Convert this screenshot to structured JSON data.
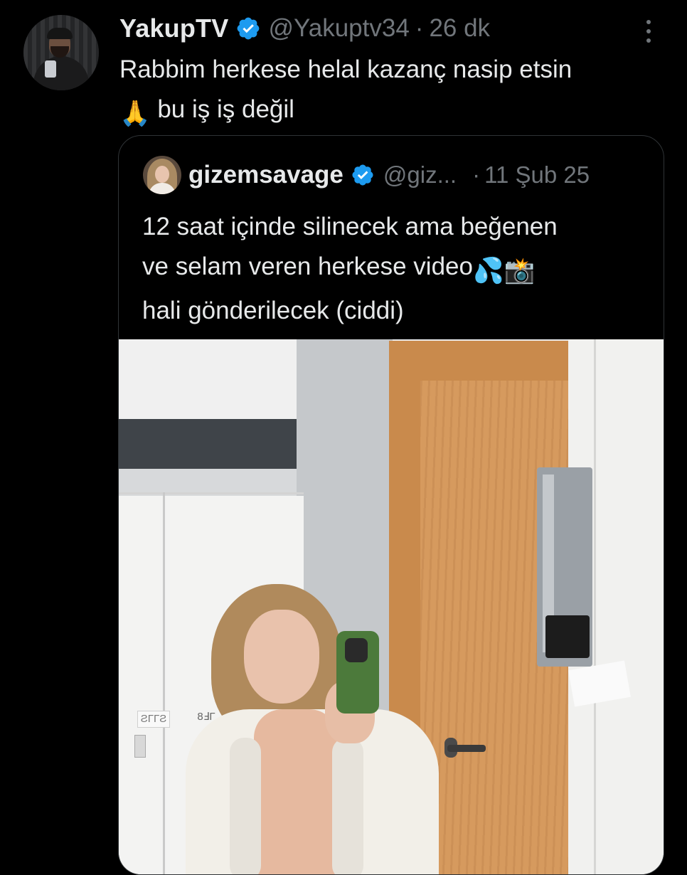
{
  "tweet": {
    "display_name": "YakupTV",
    "handle": "@Yakuptv34",
    "separator": "·",
    "time": "26 dk",
    "text_line_1": "Rabbim herkese helal kazanç nasip etsin",
    "text_line_2_emoji": "🙏",
    "text_line_2": "bu iş iş değil",
    "verified_color": "#1d9bf0"
  },
  "quote": {
    "display_name": "gizemsavage",
    "handle": "@giz...",
    "separator": "·",
    "time": "11 Şub 25",
    "text_line_1": "12 saat içinde silinecek ama beğenen",
    "text_line_2": "ve selam veren herkese video",
    "text_line_2_emoji": "💦📸",
    "text_line_3": "hali gönderilecek (ciddi)",
    "media_label_left": "ƧΓΓƧ",
    "media_label_right": "8ℲΓ"
  },
  "icons": {
    "verified": "verified-badge-icon",
    "more": "more-options-icon"
  }
}
